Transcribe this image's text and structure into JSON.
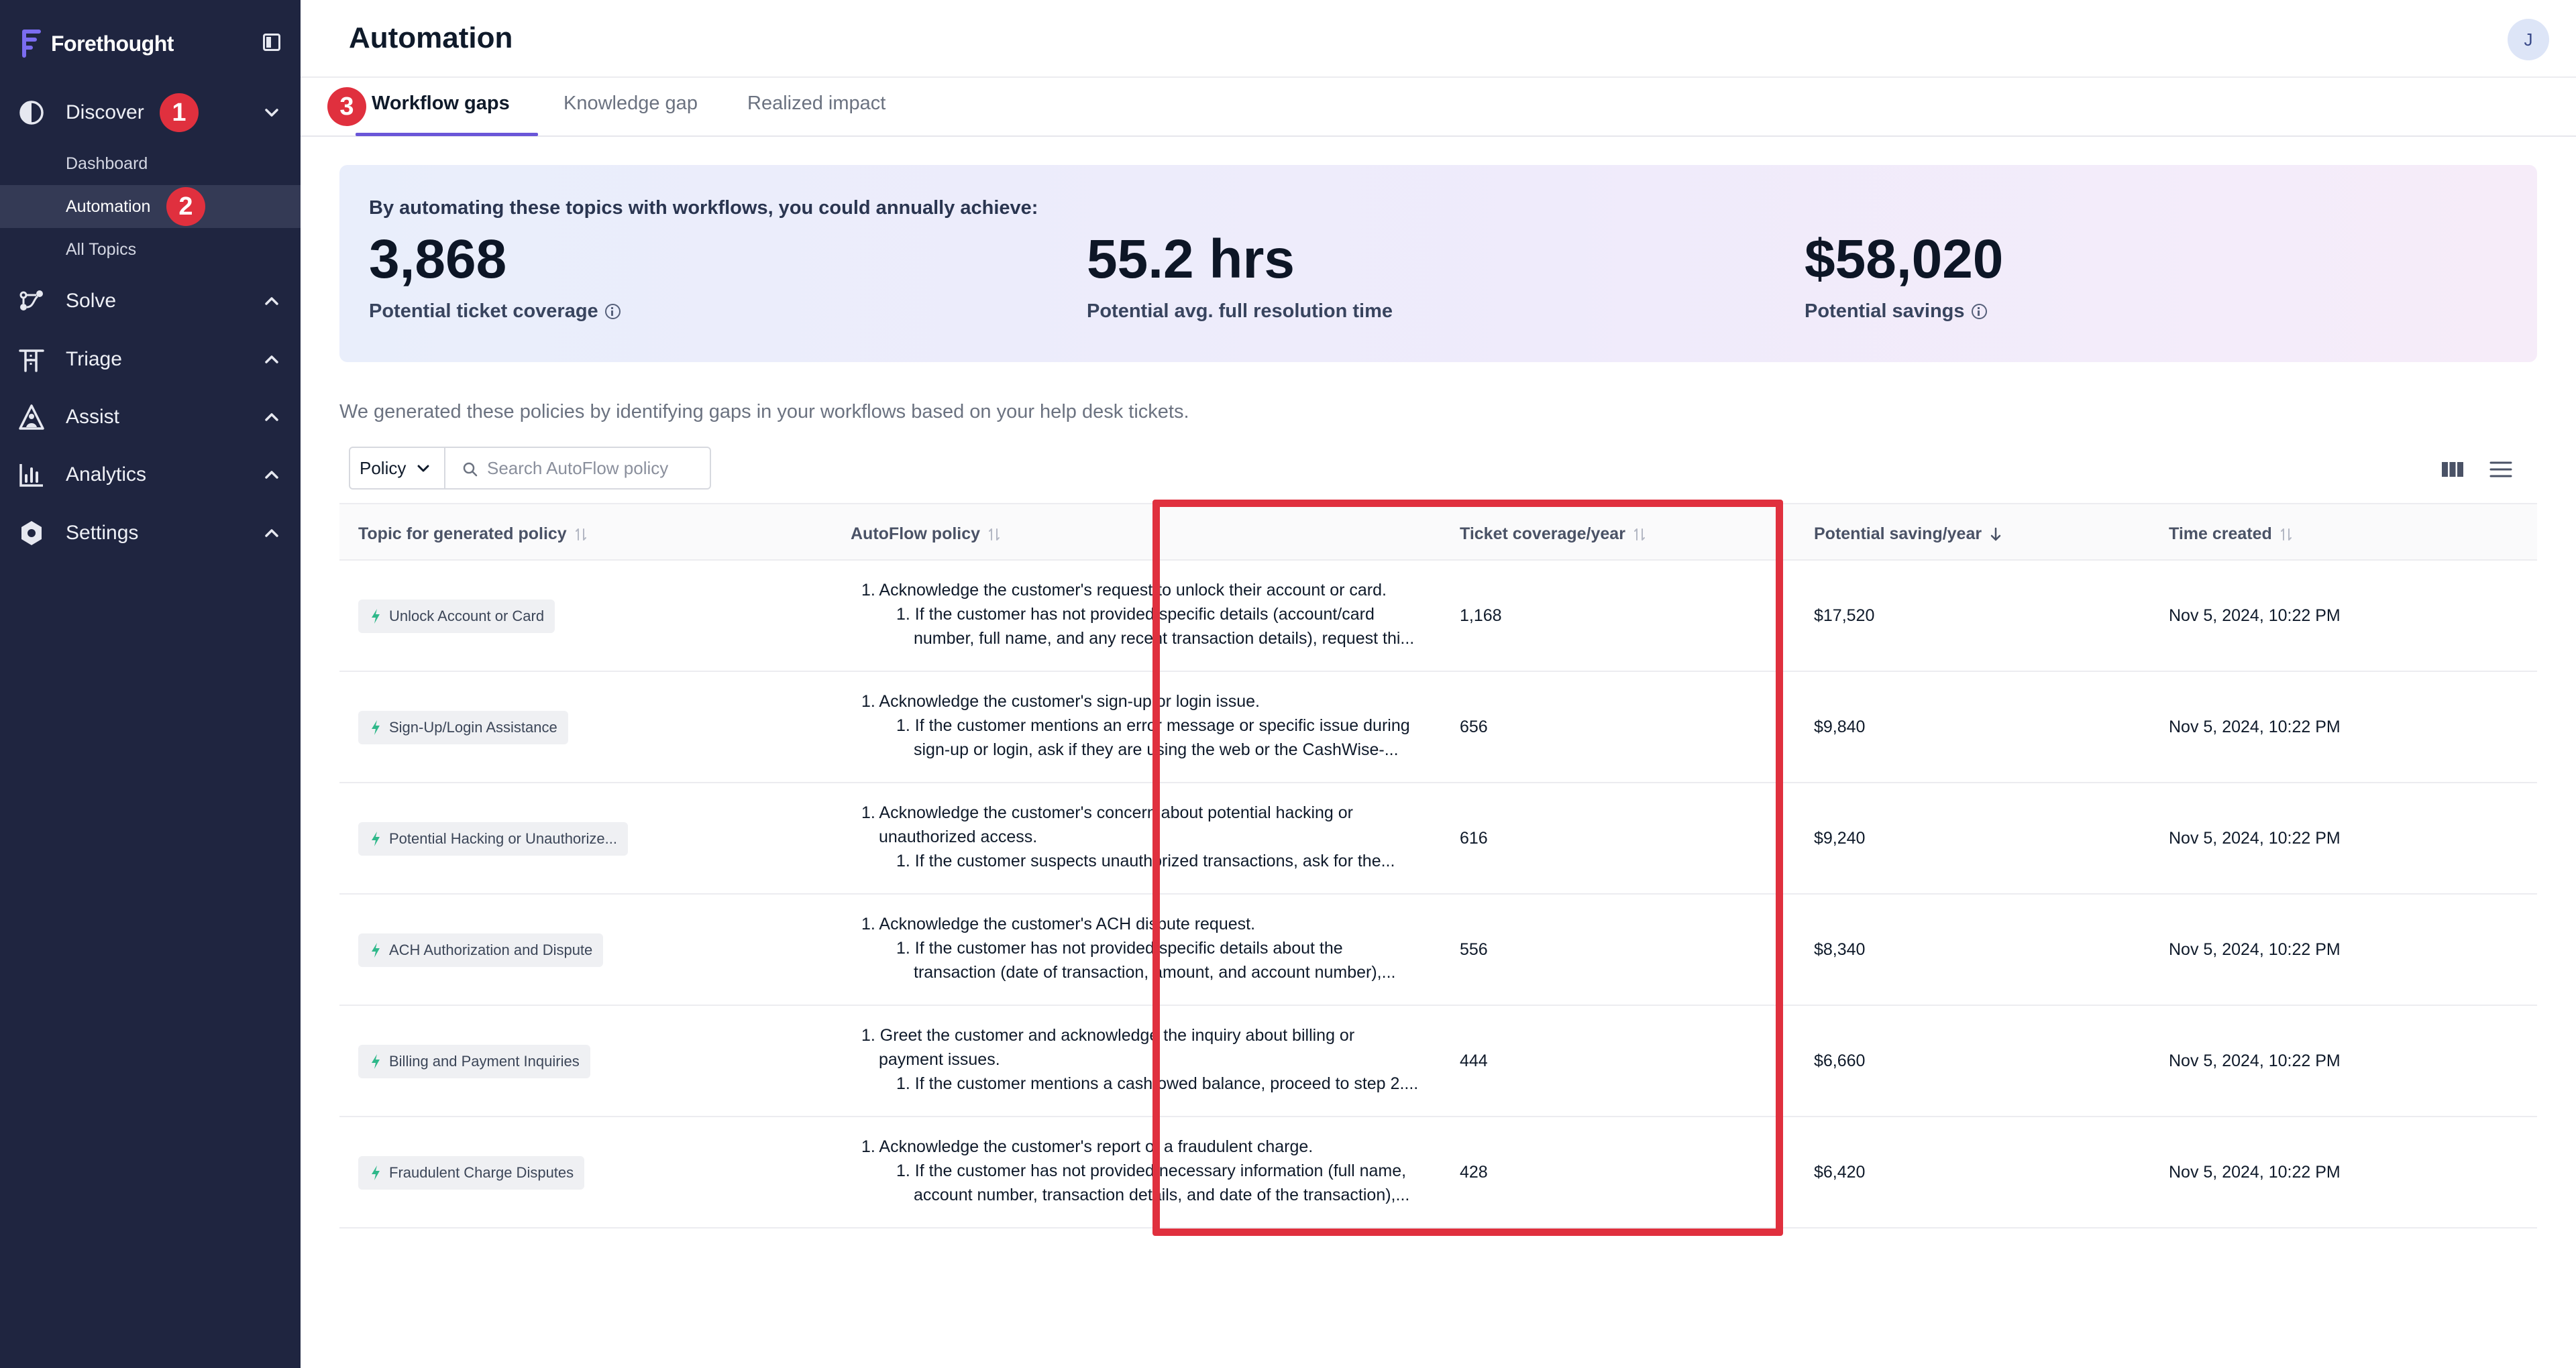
{
  "brand": {
    "name": "Forethought"
  },
  "sidebar": {
    "items": [
      {
        "label": "Discover",
        "icon": "discover-icon",
        "expanded": true,
        "children": [
          {
            "label": "Dashboard"
          },
          {
            "label": "Automation",
            "active": true
          },
          {
            "label": "All Topics"
          }
        ]
      },
      {
        "label": "Solve",
        "icon": "solve-icon"
      },
      {
        "label": "Triage",
        "icon": "triage-icon"
      },
      {
        "label": "Assist",
        "icon": "assist-icon"
      },
      {
        "label": "Analytics",
        "icon": "analytics-icon"
      },
      {
        "label": "Settings",
        "icon": "settings-icon"
      }
    ]
  },
  "badges": [
    "1",
    "2",
    "3"
  ],
  "header": {
    "title": "Automation",
    "avatar": "J"
  },
  "tabs": [
    {
      "label": "Workflow gaps",
      "active": true
    },
    {
      "label": "Knowledge gap"
    },
    {
      "label": "Realized impact"
    }
  ],
  "banner": {
    "heading": "By automating these topics with workflows, you could annually achieve:",
    "stats": [
      {
        "value": "3,868",
        "label": "Potential ticket coverage",
        "info": true
      },
      {
        "value": "55.2 hrs",
        "label": "Potential avg. full resolution time",
        "info": false
      },
      {
        "value": "$58,020",
        "label": "Potential savings",
        "info": true
      }
    ]
  },
  "intro": "We generated these policies by identifying gaps in your workflows based on your help desk tickets.",
  "filter": {
    "dropdown": "Policy",
    "search_placeholder": "Search AutoFlow policy",
    "search_value": ""
  },
  "table": {
    "columns": [
      {
        "label": "Topic for generated policy",
        "sort": "none"
      },
      {
        "label": "AutoFlow policy",
        "sort": "none"
      },
      {
        "label": "Ticket coverage/year",
        "sort": "none"
      },
      {
        "label": "Potential saving/year",
        "sort": "desc"
      },
      {
        "label": "Time created",
        "sort": "none"
      }
    ],
    "rows": [
      {
        "topic": "Unlock Account or Card",
        "policy": [
          "1. Acknowledge the customer's request to unlock their account or card.",
          "1. If the customer has not provided specific details (account/card",
          "number, full name, and any recent transaction details), request thi..."
        ],
        "coverage": "1,168",
        "saving": "$17,520",
        "created": "Nov 5, 2024, 10:22 PM"
      },
      {
        "topic": "Sign-Up/Login Assistance",
        "policy": [
          "1. Acknowledge the customer's sign-up or login issue.",
          "1. If the customer mentions an error message or specific issue during",
          "sign-up or login, ask if they are using the web or the CashWise-..."
        ],
        "coverage": "656",
        "saving": "$9,840",
        "created": "Nov 5, 2024, 10:22 PM"
      },
      {
        "topic": "Potential Hacking or Unauthorize...",
        "policy": [
          "1. Acknowledge the customer's concern about potential hacking or",
          "unauthorized access.",
          "1. If the customer suspects unauthorized transactions, ask for the..."
        ],
        "coverage": "616",
        "saving": "$9,240",
        "created": "Nov 5, 2024, 10:22 PM"
      },
      {
        "topic": "ACH Authorization and Dispute",
        "policy": [
          "1. Acknowledge the customer's ACH dispute request.",
          "1. If the customer has not provided specific details about the",
          "transaction (date of transaction, amount, and account number),..."
        ],
        "coverage": "556",
        "saving": "$8,340",
        "created": "Nov 5, 2024, 10:22 PM"
      },
      {
        "topic": "Billing and Payment Inquiries",
        "policy": [
          "1. Greet the customer and acknowledge the inquiry about billing or",
          "payment issues.",
          "1. If the customer mentions a cash owed balance, proceed to step 2...."
        ],
        "coverage": "444",
        "saving": "$6,660",
        "created": "Nov 5, 2024, 10:22 PM"
      },
      {
        "topic": "Fraudulent Charge Disputes",
        "policy": [
          "1. Acknowledge the customer's report of a fraudulent charge.",
          "1. If the customer has not provided necessary information (full name,",
          "account number, transaction details, and date of the transaction),..."
        ],
        "coverage": "428",
        "saving": "$6,420",
        "created": "Nov 5, 2024, 10:22 PM"
      }
    ]
  },
  "colors": {
    "sidebar_bg": "#1f2540",
    "accent": "#6a56d8",
    "badge": "#e0303e",
    "bolt": "#2fb88a"
  }
}
